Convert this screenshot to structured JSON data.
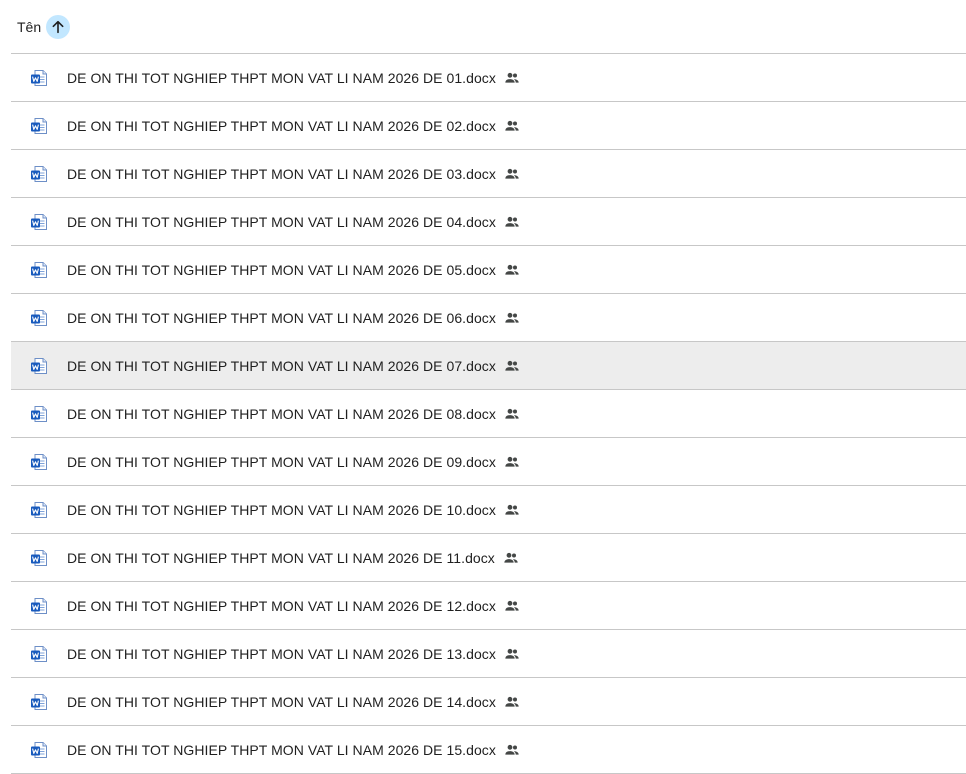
{
  "header": {
    "column_label": "Tên",
    "sort_direction_icon": "arrow-up-icon"
  },
  "colors": {
    "sort_badge": "#c2e7ff",
    "word_blue": "#185abd",
    "row_hover": "#ededed",
    "divider": "#c7c7c7"
  },
  "files": [
    {
      "name": "DE ON THI TOT NGHIEP THPT MON VAT LI NAM 2026 DE 01.docx",
      "icon": "word-doc-icon",
      "shared": true
    },
    {
      "name": "DE ON THI TOT NGHIEP THPT MON VAT LI NAM 2026 DE 02.docx",
      "icon": "word-doc-icon",
      "shared": true
    },
    {
      "name": "DE ON THI TOT NGHIEP THPT MON VAT LI NAM 2026 DE 03.docx",
      "icon": "word-doc-icon",
      "shared": true
    },
    {
      "name": "DE ON THI TOT NGHIEP THPT MON VAT LI NAM 2026 DE 04.docx",
      "icon": "word-doc-icon",
      "shared": true
    },
    {
      "name": "DE ON THI TOT NGHIEP THPT MON VAT LI NAM 2026 DE 05.docx",
      "icon": "word-doc-icon",
      "shared": true
    },
    {
      "name": "DE ON THI TOT NGHIEP THPT MON VAT LI NAM 2026 DE 06.docx",
      "icon": "word-doc-icon",
      "shared": true
    },
    {
      "name": "DE ON THI TOT NGHIEP THPT MON VAT LI NAM 2026 DE 07.docx",
      "icon": "word-doc-icon",
      "shared": true,
      "hovered": true
    },
    {
      "name": "DE ON THI TOT NGHIEP THPT MON VAT LI NAM 2026 DE 08.docx",
      "icon": "word-doc-icon",
      "shared": true
    },
    {
      "name": "DE ON THI TOT NGHIEP THPT MON VAT LI NAM 2026 DE 09.docx",
      "icon": "word-doc-icon",
      "shared": true
    },
    {
      "name": "DE ON THI TOT NGHIEP THPT MON VAT LI NAM 2026 DE 10.docx",
      "icon": "word-doc-icon",
      "shared": true
    },
    {
      "name": "DE ON THI TOT NGHIEP THPT MON VAT LI NAM 2026 DE 11.docx",
      "icon": "word-doc-icon",
      "shared": true
    },
    {
      "name": "DE ON THI TOT NGHIEP THPT MON VAT LI NAM 2026 DE 12.docx",
      "icon": "word-doc-icon",
      "shared": true
    },
    {
      "name": "DE ON THI TOT NGHIEP THPT MON VAT LI NAM 2026 DE 13.docx",
      "icon": "word-doc-icon",
      "shared": true
    },
    {
      "name": "DE ON THI TOT NGHIEP THPT MON VAT LI NAM 2026 DE 14.docx",
      "icon": "word-doc-icon",
      "shared": true
    },
    {
      "name": "DE ON THI TOT NGHIEP THPT MON VAT LI NAM 2026 DE 15.docx",
      "icon": "word-doc-icon",
      "shared": true
    }
  ]
}
